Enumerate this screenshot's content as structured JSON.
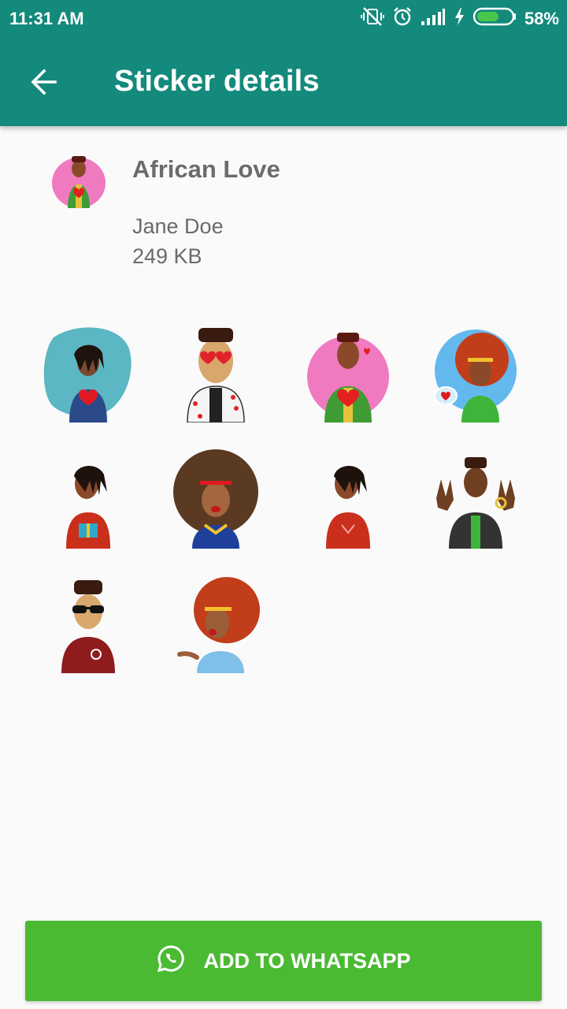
{
  "status_bar": {
    "time": "11:31 AM",
    "battery": "58%",
    "icons": [
      "vibrate-off-icon",
      "alarm-icon",
      "signal-icon",
      "charging-icon",
      "battery-icon"
    ]
  },
  "toolbar": {
    "title": "Sticker details",
    "back_icon": "arrow-left-icon"
  },
  "pack": {
    "name": "African Love",
    "publisher": "Jane Doe",
    "size": "249 KB"
  },
  "stickers": [
    {
      "name": "man-dreads-heart-blue-bg"
    },
    {
      "name": "man-heart-glasses"
    },
    {
      "name": "man-hand-heart-pink-bg"
    },
    {
      "name": "woman-red-afro-hearts-blue-bg"
    },
    {
      "name": "man-dreads-gift"
    },
    {
      "name": "woman-afro-kiss"
    },
    {
      "name": "man-dreads-red-shirt"
    },
    {
      "name": "man-hands-up"
    },
    {
      "name": "man-sunglasses-red-jacket"
    },
    {
      "name": "woman-red-afro-blowing-kiss"
    }
  ],
  "button": {
    "label": "ADD TO WHATSAPP",
    "icon": "whatsapp-icon"
  },
  "colors": {
    "toolbar": "#138a7b",
    "button": "#4bba33",
    "background": "#fafafa"
  }
}
